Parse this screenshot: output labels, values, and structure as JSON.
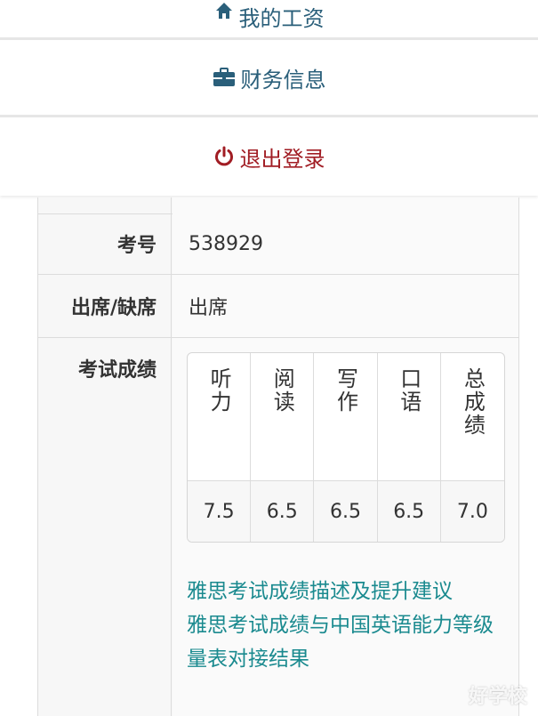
{
  "menu": {
    "my_salary": "我的工资",
    "finance": "财务信息",
    "logout": "退出登录"
  },
  "table": {
    "exam_number_label": "考号",
    "exam_number_value": "538929",
    "attendance_label": "出席/缺席",
    "attendance_value": "出席",
    "scores_label": "考试成绩",
    "score_headers": [
      "听力",
      "阅读",
      "写作",
      "口语",
      "总成绩"
    ],
    "score_values": [
      "7.5",
      "6.5",
      "6.5",
      "6.5",
      "7.0"
    ]
  },
  "links": [
    "雅思考试成绩描述及提升建议",
    "雅思考试成绩与中国英语能力等级量表对接结果"
  ],
  "watermark": "好学校",
  "colors": {
    "menu_text": "#2a5f7a",
    "logout_text": "#a11d24",
    "link_text": "#1a8a8f"
  }
}
